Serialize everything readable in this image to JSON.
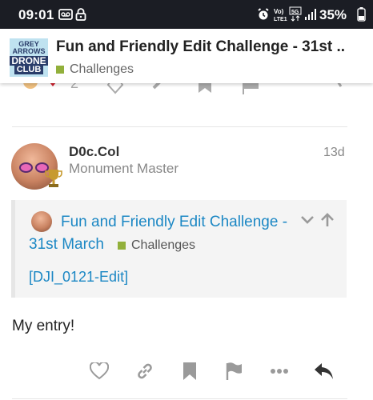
{
  "status_bar": {
    "time": "09:01",
    "network": "Vo) LTE1 5G",
    "battery_percent": "35%"
  },
  "header": {
    "logo_lines": [
      "GREY",
      "ARROWS",
      "DRONE",
      "CLUB"
    ],
    "title": "Fun and Friendly Edit Challenge - 31st ...",
    "category": "Challenges",
    "category_color": "#92b03b"
  },
  "prev_post_actions": {
    "like_count": "2"
  },
  "post": {
    "username": "D0c.Col",
    "user_title": "Monument Master",
    "date": "13d",
    "quote": {
      "title_line1": "Fun and Friendly Edit Challenge -",
      "title_line2": "31st March",
      "category": "Challenges",
      "link_text": "[DJI_0121-Edit]"
    },
    "body": "My entry!",
    "actions": [
      "heart-icon",
      "link-icon",
      "bookmark-icon",
      "flag-icon",
      "more-icon",
      "reply-icon"
    ]
  },
  "colors": {
    "link": "#1b87c4",
    "status_bar_bg": "#1b1d24",
    "icon_gray": "#9a9a9a"
  }
}
